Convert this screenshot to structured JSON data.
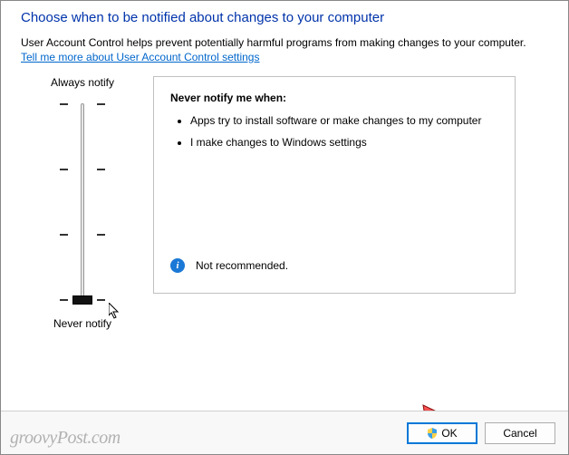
{
  "title": "Choose when to be notified about changes to your computer",
  "description": "User Account Control helps prevent potentially harmful programs from making changes to your computer.",
  "link_text": "Tell me more about User Account Control settings",
  "slider": {
    "top_label": "Always notify",
    "bottom_label": "Never notify"
  },
  "info": {
    "heading": "Never notify me when:",
    "items": [
      "Apps try to install software or make changes to my computer",
      "I make changes to Windows settings"
    ],
    "recommend": "Not recommended."
  },
  "buttons": {
    "ok": "OK",
    "cancel": "Cancel"
  },
  "watermark": "groovyPost.com"
}
